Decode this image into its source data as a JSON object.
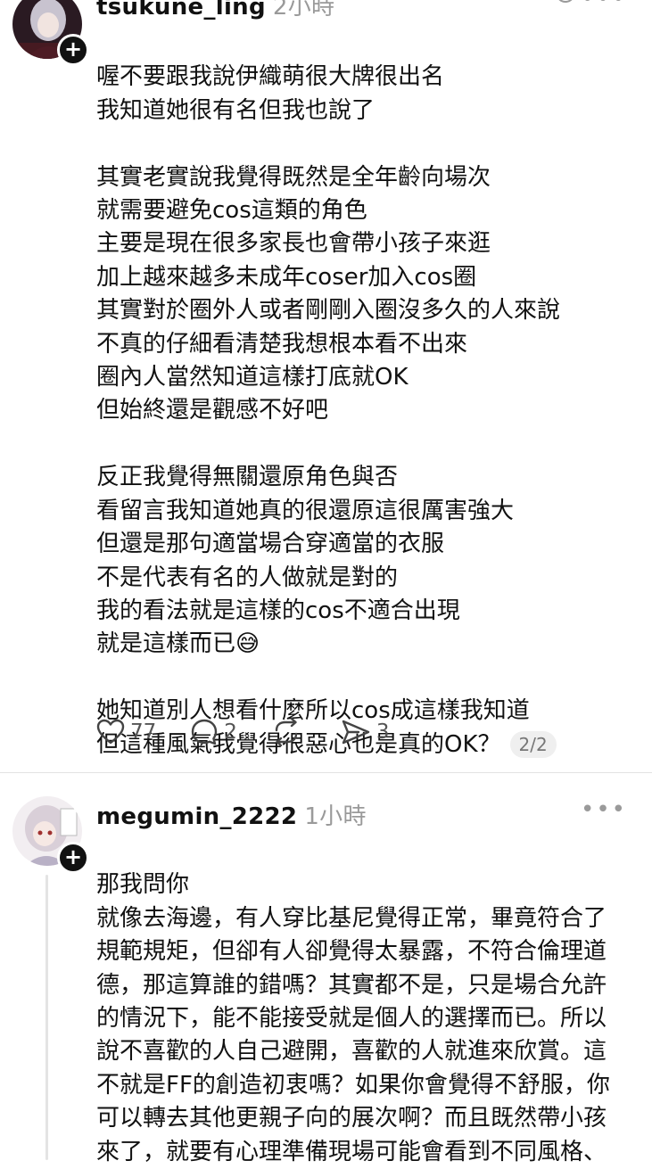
{
  "post1": {
    "username": "tsukune_ling",
    "time": "2小時",
    "body": "喔不要跟我說伊織萌很大牌很出名\n我知道她很有名但我也說了\n\n其實老實說我覺得既然是全年齡向場次\n就需要避免cos這類的角色\n主要是現在很多家長也會帶小孩子來逛\n加上越來越多未成年coser加入cos圈\n其實對於圈外人或者剛剛入圈沒多久的人來說\n不真的仔細看清楚我想根本看不出來\n圈內人當然知道這樣打底就OK\n但始終還是觀感不好吧\n\n反正我覺得無關還原角色與否\n看留言我知道她真的很還原這很厲害強大\n但還是那句適當場合穿適當的衣服\n不是代表有名的人做就是對的\n我的看法就是這樣的cos不適合出現\n就是這樣而已😅\n\n她知道別人想看什麼所以cos成這樣我知道\n但這種風氣我覺得很惡心也是真的OK？",
    "page_indicator": "2/2",
    "like_count": "77",
    "comment_count": "2",
    "share_count": "3"
  },
  "post2": {
    "username": "megumin_2222",
    "time": "1小時",
    "body": "那我問你\n就像去海邊，有人穿比基尼覺得正常，畢竟符合了\n規範規矩，但卻有人卻覺得太暴露，不符合倫理道\n德，那這算誰的錯嗎？其實都不是，只是場合允許\n的情況下，能不能接受就是個人的選擇而已。所以\n說不喜歡的人自己避開，喜歡的人就進來欣賞。這\n不就是FF的創造初衷嗎？如果你會覺得不舒服，你\n可以轉去其他更親子向的展次啊？而且既然帶小孩\n來了，就要有心理準備現場可能會看到不同風格、"
  },
  "more_label": "•••",
  "plus_label": "+"
}
